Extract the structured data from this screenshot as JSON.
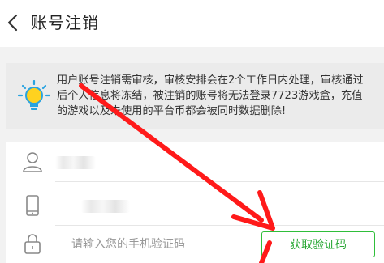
{
  "header": {
    "title": "账号注销",
    "back_icon": "chevron-left-icon"
  },
  "notice": {
    "icon": "lightbulb-icon",
    "lines": [
      "用户账号注销需审核，审核安排会在2个工作日内处理，审核通过",
      "后个人信息将冻结，被注销的账号将无法登录7723游戏盒，充值",
      "的游戏以及未使用的平台币都会被同时数据删除!"
    ]
  },
  "form": {
    "account_icon": "user-icon",
    "phone_icon": "phone-icon",
    "lock_icon": "lock-icon",
    "code_placeholder": "请输入您的手机验证码",
    "code_value": "",
    "get_code_label": "获取验证码"
  },
  "colors": {
    "accent_green": "#2fbe3a",
    "annotation_red": "#ff1a1a",
    "bulb_yellow": "#ffd21f",
    "bulb_blue": "#29a3e0"
  }
}
